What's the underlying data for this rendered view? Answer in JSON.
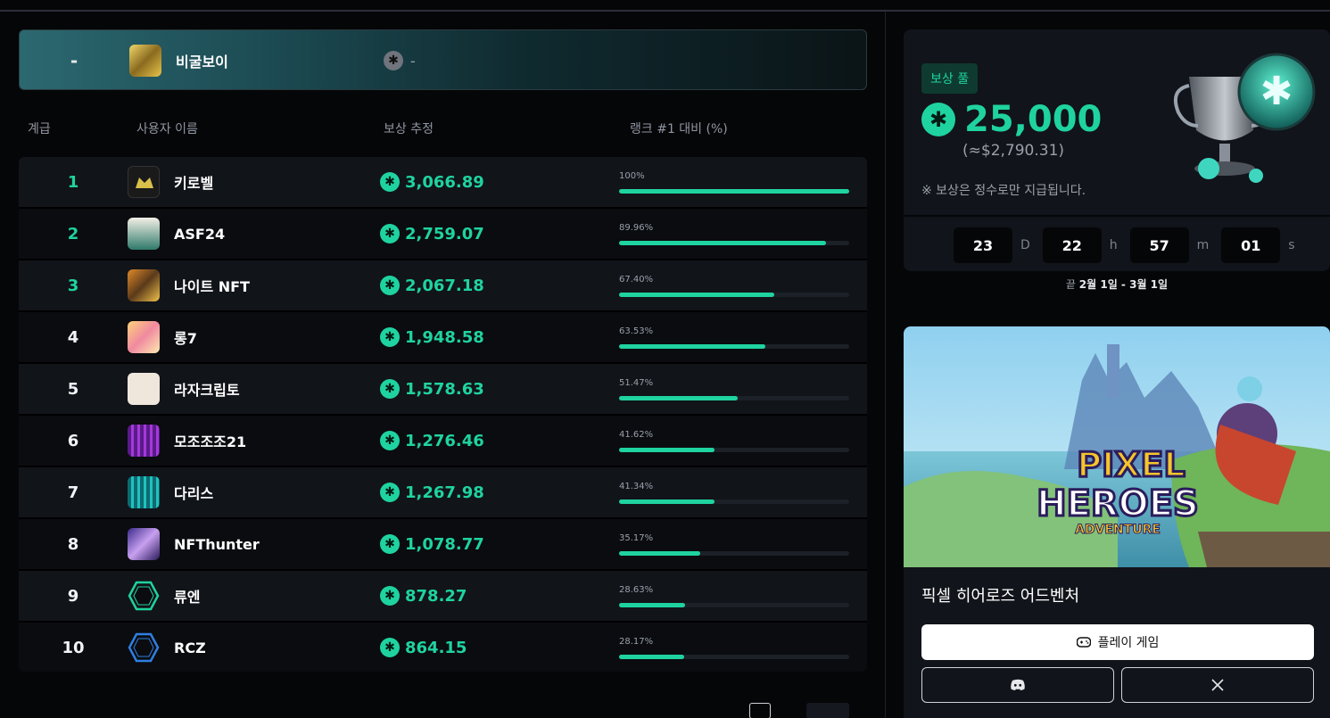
{
  "my_rank": {
    "rank": "-",
    "username": "비굴보이",
    "reward": "-"
  },
  "columns": {
    "tier": "계급",
    "username": "사용자 이름",
    "reward": "보상 추정",
    "vs_first": "랭크 #1 대비 (%)"
  },
  "leaderboard": [
    {
      "rank": "1",
      "username": "키로벨",
      "reward": "3,066.89",
      "percent_label": "100%",
      "percent": 100
    },
    {
      "rank": "2",
      "username": "ASF24",
      "reward": "2,759.07",
      "percent_label": "89.96%",
      "percent": 89.96
    },
    {
      "rank": "3",
      "username": "나이트 NFT",
      "reward": "2,067.18",
      "percent_label": "67.40%",
      "percent": 67.4
    },
    {
      "rank": "4",
      "username": "롱7",
      "reward": "1,948.58",
      "percent_label": "63.53%",
      "percent": 63.53
    },
    {
      "rank": "5",
      "username": "라자크립토",
      "reward": "1,578.63",
      "percent_label": "51.47%",
      "percent": 51.47
    },
    {
      "rank": "6",
      "username": "모조조조21",
      "reward": "1,276.46",
      "percent_label": "41.62%",
      "percent": 41.62
    },
    {
      "rank": "7",
      "username": "다리스",
      "reward": "1,267.98",
      "percent_label": "41.34%",
      "percent": 41.34
    },
    {
      "rank": "8",
      "username": "NFThunter",
      "reward": "1,078.77",
      "percent_label": "35.17%",
      "percent": 35.17
    },
    {
      "rank": "9",
      "username": "류엔",
      "reward": "878.27",
      "percent_label": "28.63%",
      "percent": 28.63
    },
    {
      "rank": "10",
      "username": "RCZ",
      "reward": "864.15",
      "percent_label": "28.17%",
      "percent": 28.17
    }
  ],
  "pool": {
    "badge": "보상 풀",
    "amount": "25,000",
    "usd": "(≈$2,790.31)",
    "note": "※ 보상은 정수로만 지급됩니다.",
    "timer": {
      "days": "23",
      "d": "D",
      "hours": "22",
      "h": "h",
      "minutes": "57",
      "m": "m",
      "seconds": "01",
      "s": "s"
    },
    "period_prefix": "끝",
    "period": "2월 1일 - 3월 1일"
  },
  "game": {
    "title": "픽셀 히어로즈 어드벤처",
    "logo_line1": "PIXEL",
    "logo_line2": "HEROES",
    "logo_line3": "ADVENTURE",
    "play_label": "플레이 게임"
  },
  "icons": {
    "coin": "coin-icon",
    "gamepad": "gamepad-icon",
    "discord": "discord-icon",
    "x": "x-icon"
  },
  "colors": {
    "accent": "#1fd3a0",
    "background": "#050608",
    "card": "#11141a"
  }
}
